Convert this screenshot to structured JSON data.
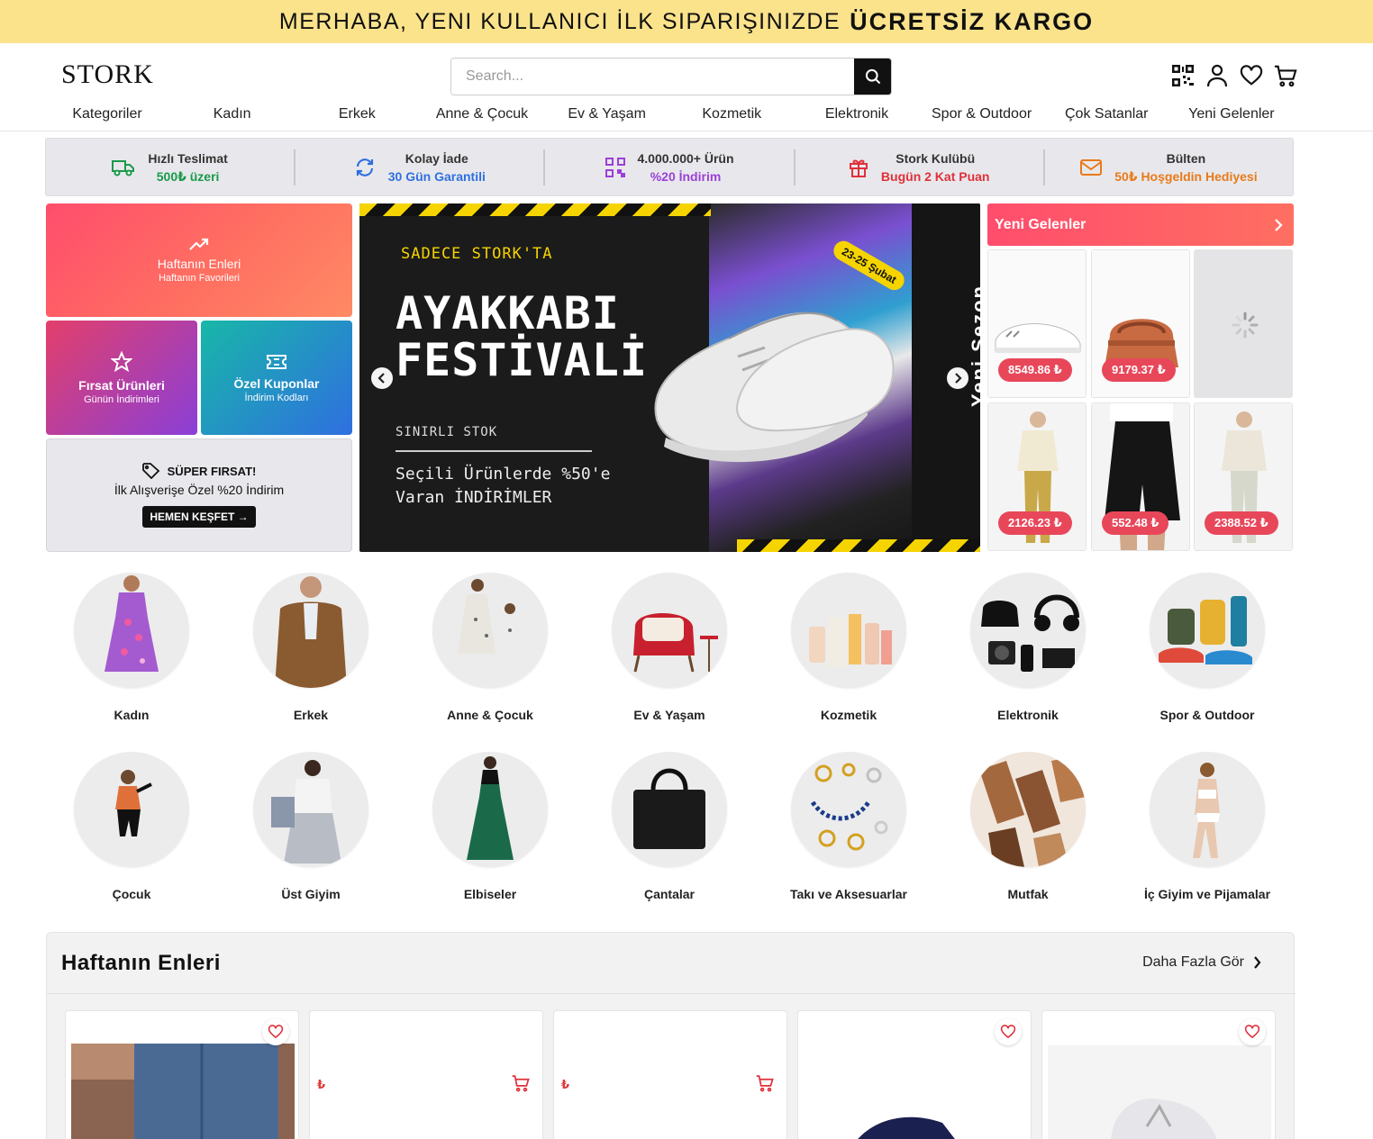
{
  "announcement": {
    "text": "MERHABA, YENI KULLANICI İLK SIPARIŞINIZDE",
    "highlight": "ÜCRETSİZ KARGO"
  },
  "header": {
    "logo": "STORK",
    "search_placeholder": "Search...",
    "icons": [
      "qr-code-icon",
      "user-icon",
      "heart-icon",
      "cart-icon"
    ]
  },
  "nav": [
    "Kategoriler",
    "Kadın",
    "Erkek",
    "Anne & Çocuk",
    "Ev & Yaşam",
    "Kozmetik",
    "Elektronik",
    "Spor & Outdoor",
    "Çok Satanlar",
    "Yeni Gelenler"
  ],
  "features": [
    {
      "title": "Hızlı Teslimat",
      "sub": "500₺ üzeri",
      "color": "#1a9a4a",
      "icon": "truck-icon"
    },
    {
      "title": "Kolay İade",
      "sub": "30 Gün Garantili",
      "color": "#2f6fe0",
      "icon": "refresh-icon"
    },
    {
      "title": "4.000.000+ Ürün",
      "sub": "%20 İndirim",
      "color": "#9b3fd8",
      "icon": "qr-icon"
    },
    {
      "title": "Stork Kulübü",
      "sub": "Bugün 2 Kat Puan",
      "color": "#e0303a",
      "icon": "gift-icon"
    },
    {
      "title": "Bülten",
      "sub": "50₺ Hoşgeldin Hediyesi",
      "color": "#e87a1a",
      "icon": "mail-icon"
    }
  ],
  "tiles": {
    "haftanin": {
      "title": "Haftanın Enleri",
      "sub": "Haftanın Favorileri"
    },
    "firsat": {
      "title": "Fırsat Ürünleri",
      "sub": "Günün İndirimleri"
    },
    "kupon": {
      "title": "Özel Kuponlar",
      "sub": "İndirim Kodları"
    },
    "super": {
      "title": "SÜPER FIRSAT!",
      "sub": "İlk Alışverişe Özel %20 İndirim",
      "cta": "HEMEN KEŞFET →"
    }
  },
  "banner": {
    "kicker": "SADECE STORK'TA",
    "title_line1": "AYAKKABI",
    "title_line2": "FESTİVALİ",
    "stock": "SINIRLI STOK",
    "desc_line1": "Seçili Ürünlerde %50'e",
    "desc_line2": "Varan İNDİRİMLER",
    "season": "Yeni Sezon",
    "date": "23-25 Şubat"
  },
  "new_arrivals": {
    "title": "Yeni Gelenler",
    "prices": [
      "8549.86 ₺",
      "9179.37 ₺",
      "",
      "2126.23 ₺",
      "552.48 ₺",
      "2388.52 ₺"
    ]
  },
  "categories": [
    "Kadın",
    "Erkek",
    "Anne & Çocuk",
    "Ev & Yaşam",
    "Kozmetik",
    "Elektronik",
    "Spor & Outdoor",
    "Çocuk",
    "Üst Giyim",
    "Elbiseler",
    "Çantalar",
    "Takı ve Aksesuarlar",
    "Mutfak",
    "İç Giyim ve Pijamalar"
  ],
  "weekly": {
    "title": "Haftanın Enleri",
    "more": "Daha Fazla Gör",
    "currency": "₺"
  }
}
